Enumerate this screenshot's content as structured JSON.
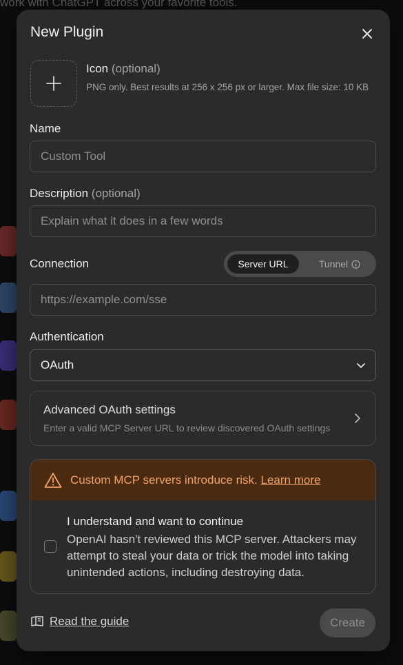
{
  "background": {
    "top_text": "work with ChatGPT across your favorite tools."
  },
  "modal": {
    "title": "New Plugin",
    "icon": {
      "label": "Icon",
      "optional": "(optional)",
      "hint": "PNG only. Best results at 256 x 256 px or larger. Max file size: 10 KB"
    },
    "name": {
      "label": "Name",
      "placeholder": "Custom Tool"
    },
    "description": {
      "label": "Description",
      "optional": "(optional)",
      "placeholder": "Explain what it does in a few words"
    },
    "connection": {
      "label": "Connection",
      "options": [
        "Server URL",
        "Tunnel"
      ],
      "selected": "Server URL",
      "placeholder": "https://example.com/sse"
    },
    "authentication": {
      "label": "Authentication",
      "value": "OAuth"
    },
    "advanced": {
      "title": "Advanced OAuth settings",
      "subtitle": "Enter a valid MCP Server URL to review discovered OAuth settings"
    },
    "warning": {
      "text": "Custom MCP servers introduce risk.",
      "link": "Learn more",
      "ack_title": "I understand and want to continue",
      "ack_body": "OpenAI hasn't reviewed this MCP server. Attackers may attempt to steal your data or trick the model into taking unintended actions, including destroying data.",
      "checked": false
    },
    "footer": {
      "guide": "Read the guide",
      "create": "Create"
    }
  },
  "colors": {
    "modal_bg": "#2b2b2b",
    "warning_bg": "#4a2a10",
    "warning_text": "#f2a468"
  }
}
